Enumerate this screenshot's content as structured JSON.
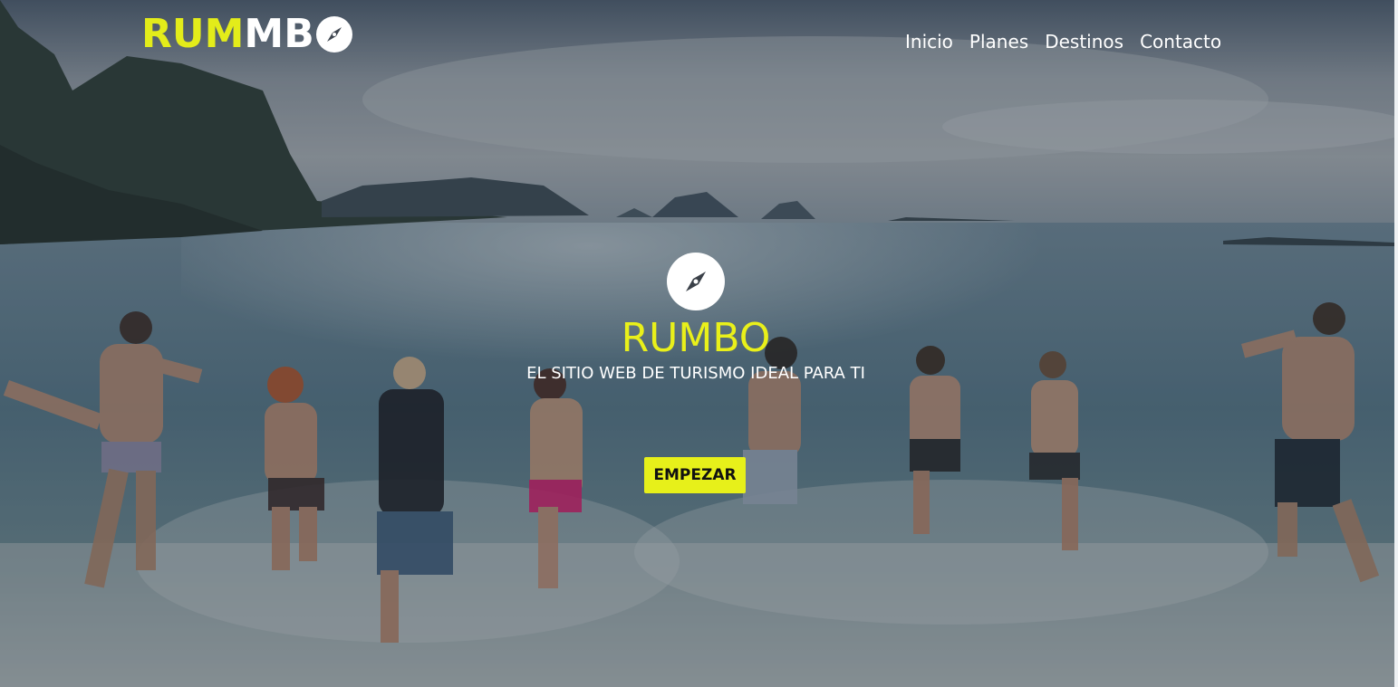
{
  "header": {
    "logo": {
      "yellow_part": "RUM",
      "white_part": "MB",
      "icon": "compass-icon"
    },
    "nav": [
      {
        "label": "Inicio"
      },
      {
        "label": "Planes"
      },
      {
        "label": "Destinos"
      },
      {
        "label": "Contacto"
      }
    ]
  },
  "hero": {
    "icon": "compass-icon",
    "title": "RUMBO",
    "subtitle": "EL SITIO WEB DE TURISMO IDEAL PARA TI",
    "cta_label": "EMPEZAR",
    "background_description_icon": "beach-photo",
    "colors": {
      "accent": "#e7f01a",
      "text": "#ffffff"
    }
  }
}
